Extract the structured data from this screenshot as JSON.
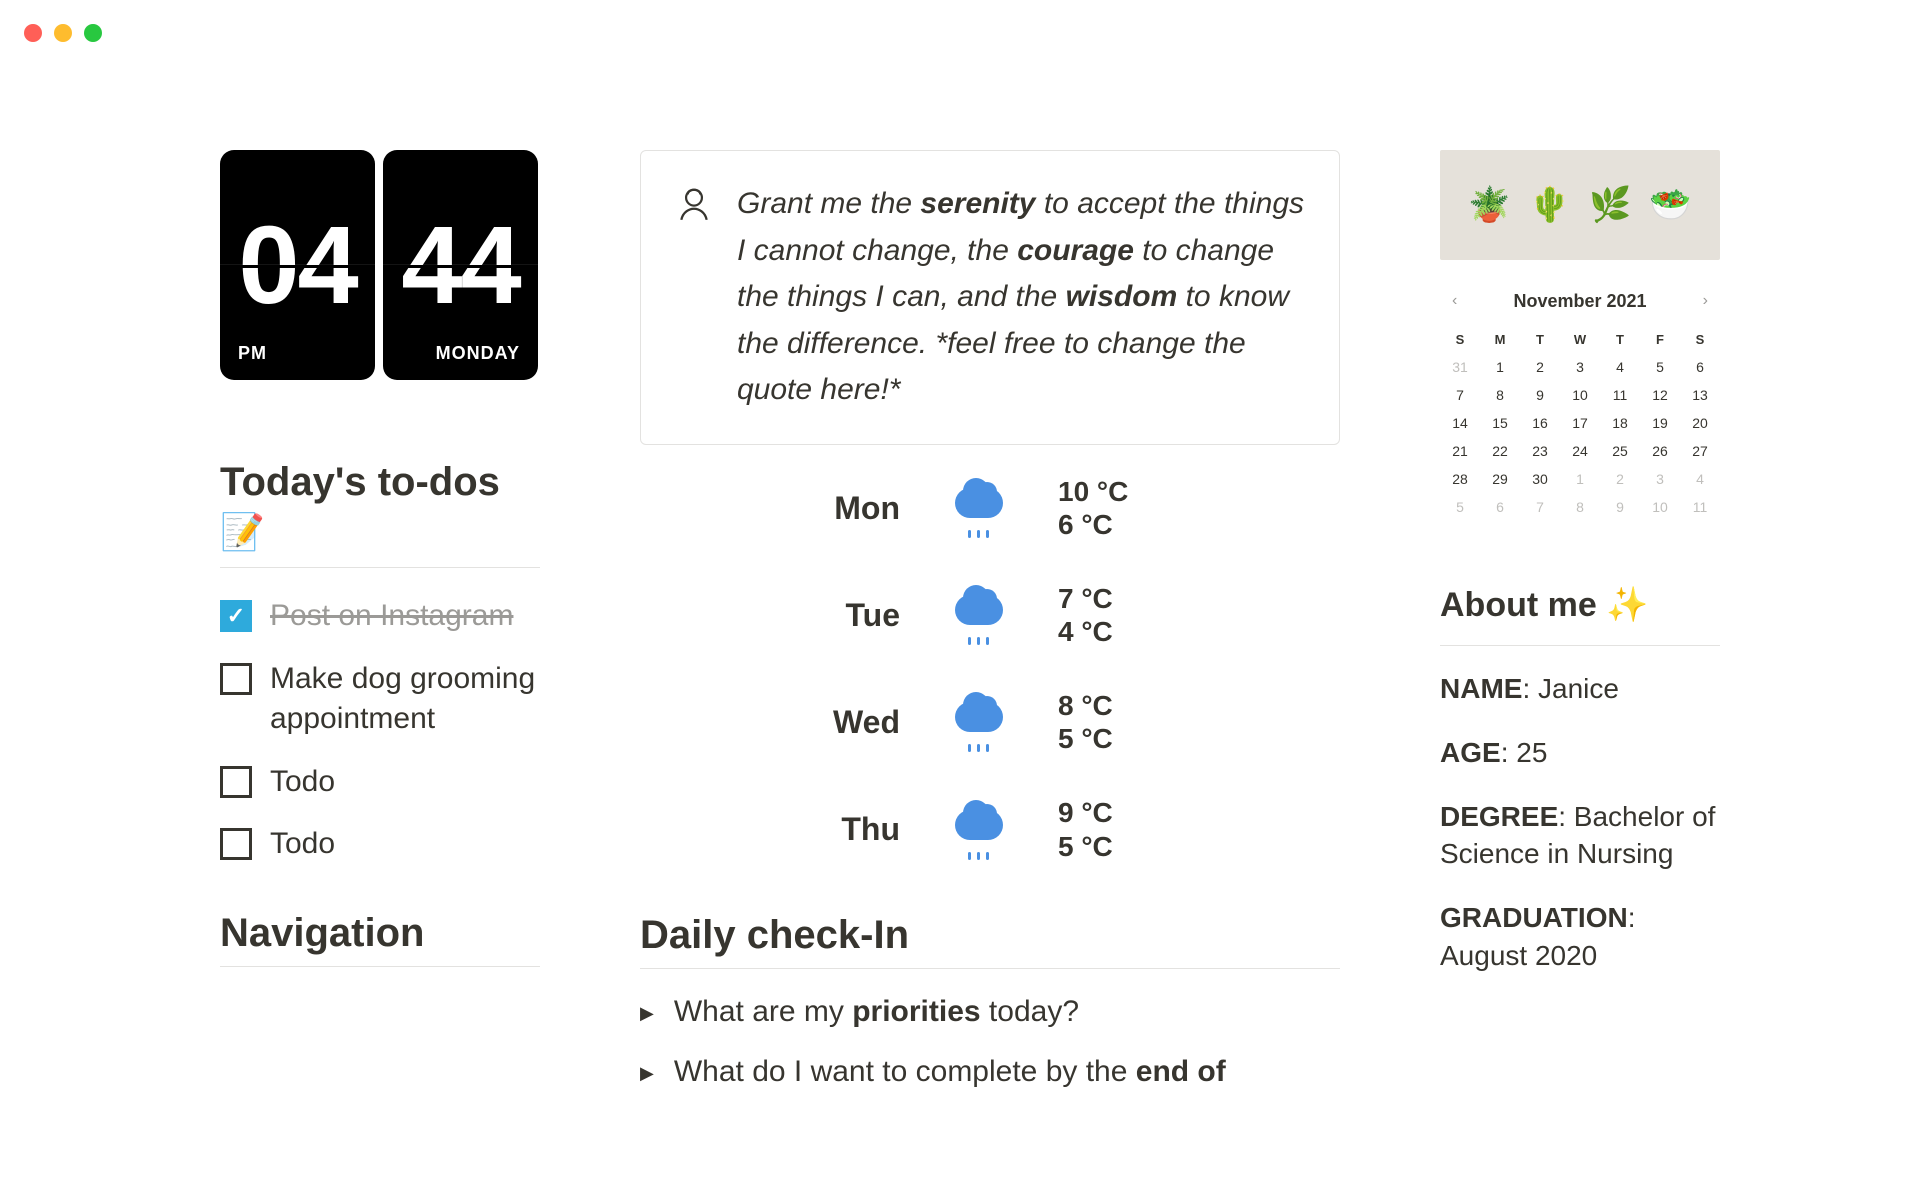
{
  "clock": {
    "hour": "04",
    "minute": "44",
    "ampm": "PM",
    "day": "MONDAY"
  },
  "todos": {
    "title": "Today's to-dos",
    "emoji": "📝",
    "items": [
      {
        "text": "Post on Instagram",
        "done": true
      },
      {
        "text": "Make dog grooming appointment",
        "done": false
      },
      {
        "text": "Todo",
        "done": false
      },
      {
        "text": "Todo",
        "done": false
      }
    ]
  },
  "navigation": {
    "title": "Navigation"
  },
  "quote": {
    "html": "Grant me the <b>serenity</b> to accept the things I cannot change, the <b>courage</b> to change the things I can, and the <b>wisdom</b> to know the difference. *feel free to change the quote here!*"
  },
  "weather": [
    {
      "day": "Mon",
      "hi": "10 °C",
      "lo": "6 °C"
    },
    {
      "day": "Tue",
      "hi": "7 °C",
      "lo": "4 °C"
    },
    {
      "day": "Wed",
      "hi": "8 °C",
      "lo": "5 °C"
    },
    {
      "day": "Thu",
      "hi": "9 °C",
      "lo": "5 °C"
    }
  ],
  "checkin": {
    "title": "Daily check-In",
    "items": [
      "What are my <b>priorities</b> today?",
      "What do I want to complete by the <b>end of</b>"
    ]
  },
  "calendar": {
    "month": "November 2021",
    "dow": [
      "S",
      "M",
      "T",
      "W",
      "T",
      "F",
      "S"
    ],
    "leading_muted": [
      "31"
    ],
    "days": [
      1,
      2,
      3,
      4,
      5,
      6,
      7,
      8,
      9,
      10,
      11,
      12,
      13,
      14,
      15,
      16,
      17,
      18,
      19,
      20,
      21,
      22,
      23,
      24,
      25,
      26,
      27,
      28,
      29,
      30
    ],
    "trailing_muted": [
      "1",
      "2",
      "3",
      "4",
      "5",
      "6",
      "7",
      "8",
      "9",
      "10",
      "11"
    ]
  },
  "about": {
    "title": "About me ✨",
    "items": [
      {
        "label": "NAME",
        "value": "Janice"
      },
      {
        "label": "AGE",
        "value": "25"
      },
      {
        "label": "DEGREE",
        "value": "Bachelor of Science in Nursing"
      },
      {
        "label": "GRADUATION",
        "value": "August 2020"
      }
    ]
  }
}
